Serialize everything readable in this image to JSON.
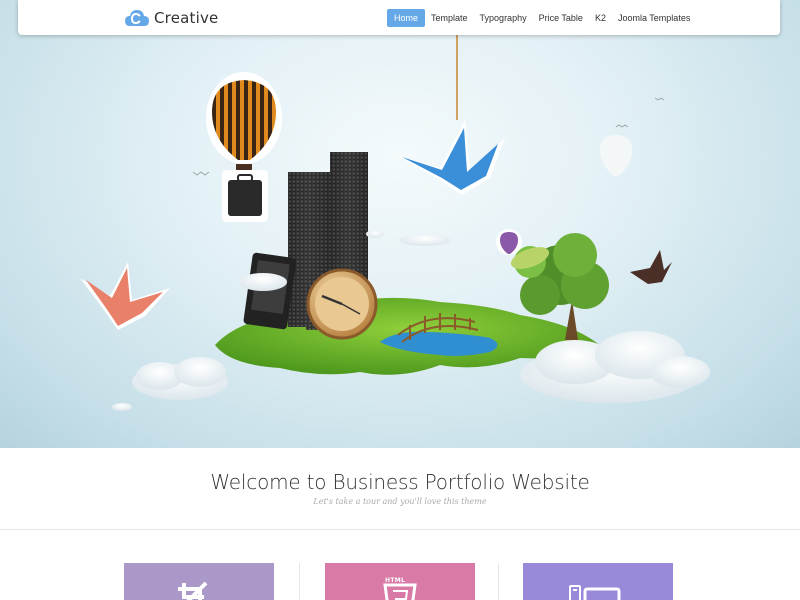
{
  "brand": {
    "name": "Creative",
    "logo_icon": "cloud-c-logo",
    "logo_color": "#64a8e8"
  },
  "nav": {
    "items": [
      {
        "label": "Home",
        "active": true
      },
      {
        "label": "Template",
        "active": false
      },
      {
        "label": "Typography",
        "active": false
      },
      {
        "label": "Price Table",
        "active": false
      },
      {
        "label": "K2",
        "active": false
      },
      {
        "label": "Joomla Templates",
        "active": false
      }
    ],
    "active_color": "#64a8e8"
  },
  "welcome": {
    "title": "Welcome to Business Portfolio Website",
    "subtitle": "Let's take a tour and you'll love this theme"
  },
  "features": [
    {
      "icon": "crop-icon",
      "color": "#a998c8"
    },
    {
      "icon": "html5-icon",
      "label": "HTML",
      "color": "#d97aa6"
    },
    {
      "icon": "devices-icon",
      "color": "#9a88d9"
    }
  ]
}
